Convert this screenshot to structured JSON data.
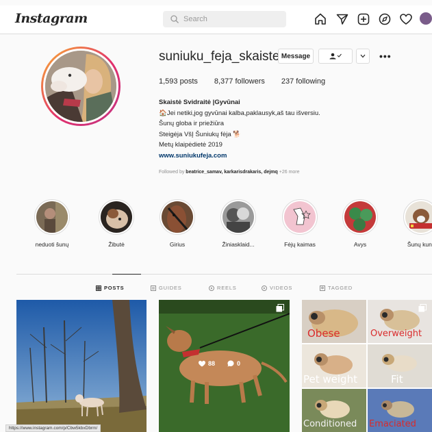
{
  "nav": {
    "logo": "Instagram",
    "search_placeholder": "Search",
    "icons": [
      "home-icon",
      "direct-icon",
      "new-post-icon",
      "explore-icon",
      "activity-heart-icon",
      "profile-avatar-icon"
    ]
  },
  "profile": {
    "username": "suniuku_feja_skaiste",
    "message_button": "Message",
    "posts": "1,593 posts",
    "followers": "8,377 followers",
    "following": "237 following",
    "full_name": "Skaistė Svidraitė |Gyvūnai",
    "bio_lines": [
      "Jei netiki,jog gyvūnai kalba,paklausyk,aš tau išversiu.",
      "Šunų globa ir priežiūra",
      "Steigėja VšĮ Šuniukų fėja",
      "Metų klaipėdietė 2019"
    ],
    "website": "www.suniukufeja.com",
    "followed_by_prefix": "Followed by ",
    "followed_by_names": "beatrice_samav, karkarisdrakaris, dejmq",
    "followed_by_more": " +26 more"
  },
  "highlights": [
    {
      "label": "neduoti šunų"
    },
    {
      "label": "Žibutė"
    },
    {
      "label": "Girius"
    },
    {
      "label": "Žiniasklaid..."
    },
    {
      "label": "Fėjų kaimas"
    },
    {
      "label": "Avys"
    },
    {
      "label": "Šunų kunc"
    }
  ],
  "tabs": [
    {
      "label": "POSTS",
      "active": true
    },
    {
      "label": "GUIDES",
      "active": false
    },
    {
      "label": "REELS",
      "active": false
    },
    {
      "label": "VIDEOS",
      "active": false
    },
    {
      "label": "TAGGED",
      "active": false
    }
  ],
  "posts": [
    {
      "likes": "",
      "comments": ""
    },
    {
      "likes": "88",
      "comments": "0"
    },
    {
      "likes": "",
      "comments": ""
    }
  ],
  "pug_labels": [
    "Obese",
    "Overweight",
    "Pet weight",
    "Fit",
    "Conditioned",
    "Emaciated"
  ],
  "status_url": "https://www.instagram.com/p/Cbw5kbxDbrm/",
  "colors": {
    "accent_red": "#d92b2b",
    "link": "#00376b",
    "ring_start": "#f9b233",
    "ring_end": "#c13584"
  }
}
